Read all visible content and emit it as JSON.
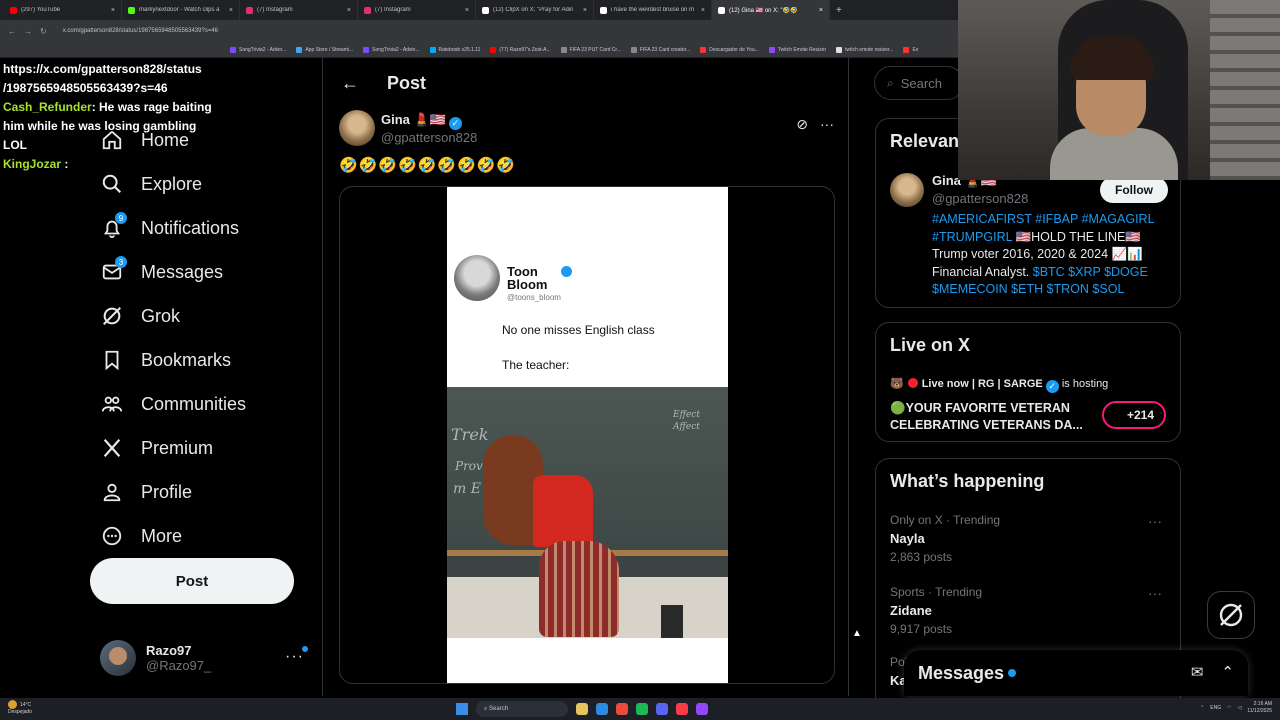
{
  "browser": {
    "tabs": [
      {
        "title": "(297) YouTube",
        "color": "#ff0000"
      },
      {
        "title": "markynextdoor - Watch clips a",
        "color": "#53fc18"
      },
      {
        "title": "(7) Instagram",
        "color": "#e1306c"
      },
      {
        "title": "(7) Instagram",
        "color": "#e1306c"
      },
      {
        "title": "(12) ClipX on X: \"Pray for Adin",
        "color": "#ffffff"
      },
      {
        "title": "i have the weirdest bruise on m",
        "color": "#ffffff"
      },
      {
        "title": "(12) Gina 🇺🇸 on X: \"🤣🤣",
        "color": "#ffffff",
        "active": true
      }
    ],
    "new_tab": "+",
    "url": "x.com/gpatterson828/status/1987565948505563439?s=46",
    "bookmarks": [
      {
        "label": "SongTrivia2 - Advin...",
        "color": "#7b4cff"
      },
      {
        "label": "App Store / Streami...",
        "color": "#3ea6ff"
      },
      {
        "label": "SongTrivia2 - Advin...",
        "color": "#7b4cff"
      },
      {
        "label": "Rateboob v25.1.11",
        "color": "#00a8ff"
      },
      {
        "label": "(77) Razo97's Zest-A...",
        "color": "#ff0000"
      },
      {
        "label": "FIFA 23 PUT Card Cr...",
        "color": "#888888"
      },
      {
        "label": "FIFA 23 Card creator...",
        "color": "#888888"
      },
      {
        "label": "Descargador de You...",
        "color": "#ff3333"
      },
      {
        "label": "Twitch Emote Resizer",
        "color": "#9146ff"
      },
      {
        "label": "twitch emote resizer...",
        "color": "#e0e0e0"
      },
      {
        "label": "Ex",
        "color": "#ff3333"
      }
    ]
  },
  "chat": {
    "line0": "https://x.com/gpatterson828/status",
    "line1": "/1987565948505563439?s=46",
    "user1": "Cash_Refunder",
    "msg1": ": He was rage baiting him while he was losing gambling LOL",
    "user2": "KingJozar",
    "msg2": " :"
  },
  "nav": {
    "items": [
      {
        "label": "Home",
        "icon": "home-icon"
      },
      {
        "label": "Explore",
        "icon": "search-icon"
      },
      {
        "label": "Notifications",
        "icon": "bell-icon",
        "badge": "9"
      },
      {
        "label": "Messages",
        "icon": "envelope-icon",
        "badge": "3"
      },
      {
        "label": "Grok",
        "icon": "grok-icon"
      },
      {
        "label": "Bookmarks",
        "icon": "bookmark-icon"
      },
      {
        "label": "Communities",
        "icon": "communities-icon"
      },
      {
        "label": "Premium",
        "icon": "x-logo-icon"
      },
      {
        "label": "Profile",
        "icon": "person-icon"
      },
      {
        "label": "More",
        "icon": "more-circle-icon"
      }
    ],
    "post_button": "Post",
    "account": {
      "name": "Razo97",
      "handle": "@Razo97_",
      "more": "···"
    }
  },
  "main": {
    "title": "Post",
    "post": {
      "author_name": "Gina 💄🇺🇸",
      "author_handle": "@gpatterson828",
      "text": "🤣🤣🤣🤣🤣🤣🤣🤣🤣",
      "embedded": {
        "name": "Toon Bloom",
        "handle": "@toons_bloom",
        "line1": "No one misses English class",
        "line2": "The teacher:",
        "chalk1": "Trek",
        "chalk2": "Prove",
        "chalk3": "m E",
        "chalk4": "Effect Affect"
      }
    }
  },
  "right": {
    "search_placeholder": "Search",
    "relevant": {
      "title": "Relevant people",
      "name": "Gina 💄🇺🇸",
      "handle": "@gpatterson828",
      "follow": "Follow",
      "bio_tags1": "#AMERICAFIRST #IFBAP #MAGAGIRL #TRUMPGIRL",
      "bio_text1": " 🇺🇸HOLD THE LINE🇺🇸 Trump voter 2016, 2020 & 2024 📈📊 Financial Analyst. ",
      "bio_tags2": "$BTC $XRP $DOGE $MEMECOIN $ETH $TRON $SOL"
    },
    "live": {
      "title": "Live on X",
      "host_prefix": "🐻",
      "host_name": "Live now | RG | SARGE",
      "host_suffix": "is hosting",
      "space_title": "🟢YOUR FAVORITE VETERAN CELEBRATING VETERANS DA...",
      "listeners": "+214"
    },
    "happening": {
      "title": "What’s happening",
      "trends": [
        {
          "meta": "Only on X · Trending",
          "topic": "Nayla",
          "count": "2,863 posts"
        },
        {
          "meta": "Sports · Trending",
          "topic": "Zidane",
          "count": "9,917 posts"
        },
        {
          "meta": "Poli",
          "topic": "Ka",
          "count": ""
        }
      ]
    },
    "messages_drawer": "Messages"
  },
  "taskbar": {
    "weather_temp": "14°C",
    "weather_desc": "Despejado",
    "search": "Search",
    "lang": "ENG",
    "time": "2:16 AM",
    "date": "11/12/2025"
  }
}
